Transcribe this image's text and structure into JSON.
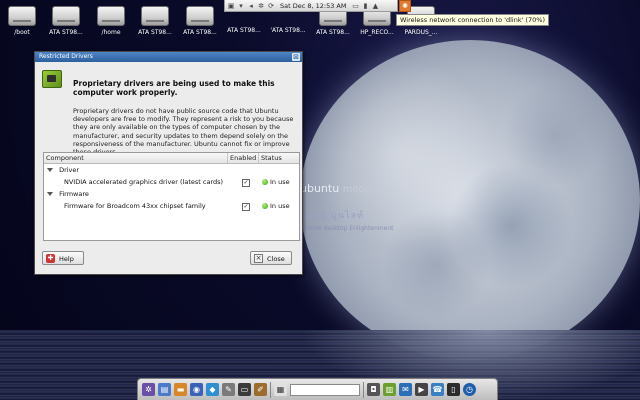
{
  "desktop": {
    "drives": [
      {
        "label": "/boot"
      },
      {
        "label": "ATA ST98..."
      },
      {
        "label": "/home"
      },
      {
        "label": "ATA ST98..."
      },
      {
        "label": "ATA ST98..."
      },
      {
        "label": "ATA ST98..."
      },
      {
        "label": "'ATA ST98..."
      },
      {
        "label": "ATA ST98..."
      },
      {
        "label": "HP_RECO..."
      },
      {
        "label": "PARDUS_..."
      }
    ],
    "branding": {
      "title": "ubuntu",
      "subtitle_word": "moonlight",
      "sub_script": "อูบุนตู มูนไลท์",
      "note": "Gnome desktop Enlightenment"
    }
  },
  "top_panel": {
    "clock": "Sat Dec  8, 12:53 AM",
    "tooltip": "Wireless network connection to 'dlink' (70%)"
  },
  "dialog": {
    "title": "Restricted Drivers",
    "heading": "Proprietary drivers are being used to make this computer work properly.",
    "body": "Proprietary drivers do not have public source code that Ubuntu developers are free to modify. They represent a risk to you because they are only available on the types of computer chosen by the manufacturer, and security updates to them depend solely on the responsiveness of the manufacturer. Ubuntu cannot fix or improve these drivers.",
    "columns": [
      "Component",
      "Enabled",
      "Status"
    ],
    "groups": [
      {
        "name": "Driver",
        "items": [
          {
            "name": "NVIDIA accelerated graphics driver (latest cards)",
            "enabled": "✓",
            "status": "In use"
          }
        ]
      },
      {
        "name": "Firmware",
        "items": [
          {
            "name": "Firmware for Broadcom 43xx chipset family",
            "enabled": "✓",
            "status": "In use"
          }
        ]
      }
    ],
    "help_label": "Help",
    "close_label": "Close"
  },
  "colors": {
    "titlebar": "#2c5f9e",
    "status_ok": "#3b9c0f",
    "tooltip_bg": "#ffffe1"
  }
}
